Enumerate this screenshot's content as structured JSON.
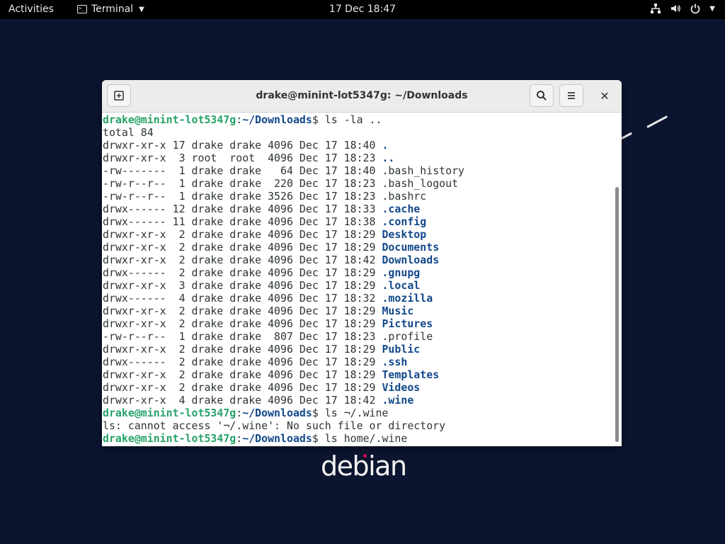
{
  "topbar": {
    "activities": "Activities",
    "app_name": "Terminal",
    "clock": "17 Dec  18:47"
  },
  "window": {
    "title": "drake@minint-lot5347g: ~/Downloads"
  },
  "terminal": {
    "lines": [
      {
        "type": "prompt",
        "user": "drake@minint-lot5347g",
        "path": "~/Downloads",
        "cmd": "ls -la .."
      },
      {
        "type": "text",
        "text": "total 84"
      },
      {
        "type": "entry",
        "meta": "drwxr-xr-x 17 drake drake 4096 Dec 17 18:40 ",
        "name": ".",
        "dir": true
      },
      {
        "type": "entry",
        "meta": "drwxr-xr-x  3 root  root  4096 Dec 17 18:23 ",
        "name": "..",
        "dir": true
      },
      {
        "type": "entry",
        "meta": "-rw-------  1 drake drake   64 Dec 17 18:40 ",
        "name": ".bash_history",
        "dir": false
      },
      {
        "type": "entry",
        "meta": "-rw-r--r--  1 drake drake  220 Dec 17 18:23 ",
        "name": ".bash_logout",
        "dir": false
      },
      {
        "type": "entry",
        "meta": "-rw-r--r--  1 drake drake 3526 Dec 17 18:23 ",
        "name": ".bashrc",
        "dir": false
      },
      {
        "type": "entry",
        "meta": "drwx------ 12 drake drake 4096 Dec 17 18:33 ",
        "name": ".cache",
        "dir": true
      },
      {
        "type": "entry",
        "meta": "drwx------ 11 drake drake 4096 Dec 17 18:38 ",
        "name": ".config",
        "dir": true
      },
      {
        "type": "entry",
        "meta": "drwxr-xr-x  2 drake drake 4096 Dec 17 18:29 ",
        "name": "Desktop",
        "dir": true
      },
      {
        "type": "entry",
        "meta": "drwxr-xr-x  2 drake drake 4096 Dec 17 18:29 ",
        "name": "Documents",
        "dir": true
      },
      {
        "type": "entry",
        "meta": "drwxr-xr-x  2 drake drake 4096 Dec 17 18:42 ",
        "name": "Downloads",
        "dir": true
      },
      {
        "type": "entry",
        "meta": "drwx------  2 drake drake 4096 Dec 17 18:29 ",
        "name": ".gnupg",
        "dir": true
      },
      {
        "type": "entry",
        "meta": "drwxr-xr-x  3 drake drake 4096 Dec 17 18:29 ",
        "name": ".local",
        "dir": true
      },
      {
        "type": "entry",
        "meta": "drwx------  4 drake drake 4096 Dec 17 18:32 ",
        "name": ".mozilla",
        "dir": true
      },
      {
        "type": "entry",
        "meta": "drwxr-xr-x  2 drake drake 4096 Dec 17 18:29 ",
        "name": "Music",
        "dir": true
      },
      {
        "type": "entry",
        "meta": "drwxr-xr-x  2 drake drake 4096 Dec 17 18:29 ",
        "name": "Pictures",
        "dir": true
      },
      {
        "type": "entry",
        "meta": "-rw-r--r--  1 drake drake  807 Dec 17 18:23 ",
        "name": ".profile",
        "dir": false
      },
      {
        "type": "entry",
        "meta": "drwxr-xr-x  2 drake drake 4096 Dec 17 18:29 ",
        "name": "Public",
        "dir": true
      },
      {
        "type": "entry",
        "meta": "drwx------  2 drake drake 4096 Dec 17 18:29 ",
        "name": ".ssh",
        "dir": true
      },
      {
        "type": "entry",
        "meta": "drwxr-xr-x  2 drake drake 4096 Dec 17 18:29 ",
        "name": "Templates",
        "dir": true
      },
      {
        "type": "entry",
        "meta": "drwxr-xr-x  2 drake drake 4096 Dec 17 18:29 ",
        "name": "Videos",
        "dir": true
      },
      {
        "type": "entry",
        "meta": "drwxr-xr-x  4 drake drake 4096 Dec 17 18:42 ",
        "name": ".wine",
        "dir": true
      },
      {
        "type": "prompt",
        "user": "drake@minint-lot5347g",
        "path": "~/Downloads",
        "cmd": "ls ¬/.wine"
      },
      {
        "type": "text",
        "text": "ls: cannot access '¬/.wine': No such file or directory"
      },
      {
        "type": "prompt",
        "user": "drake@minint-lot5347g",
        "path": "~/Downloads",
        "cmd": "ls home/.wine"
      }
    ]
  },
  "desktop": {
    "logo_text": "debian"
  },
  "colors": {
    "desktop_bg": "#0c1530",
    "prompt_user": "#26a269",
    "directory": "#12488b",
    "debian_red": "#d70751"
  }
}
